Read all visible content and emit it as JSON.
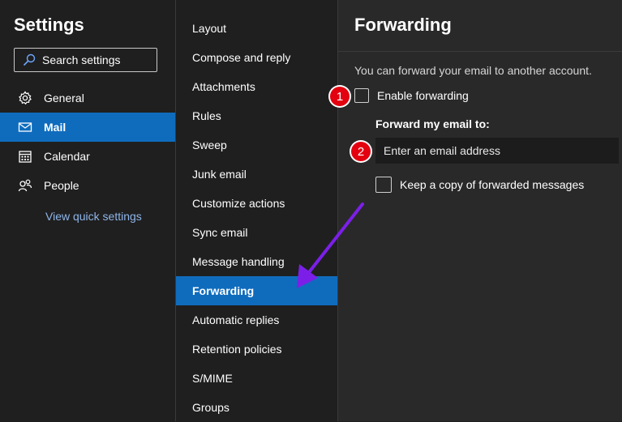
{
  "sidebar": {
    "title": "Settings",
    "search_placeholder": "Search settings",
    "items": [
      {
        "label": "General",
        "icon": "gear-icon"
      },
      {
        "label": "Mail",
        "icon": "mail-icon"
      },
      {
        "label": "Calendar",
        "icon": "calendar-icon"
      },
      {
        "label": "People",
        "icon": "people-icon"
      }
    ],
    "selected": "Mail",
    "quick_link": "View quick settings"
  },
  "submenu": {
    "items": [
      "Layout",
      "Compose and reply",
      "Attachments",
      "Rules",
      "Sweep",
      "Junk email",
      "Customize actions",
      "Sync email",
      "Message handling",
      "Forwarding",
      "Automatic replies",
      "Retention policies",
      "S/MIME",
      "Groups"
    ],
    "selected": "Forwarding"
  },
  "pane": {
    "title": "Forwarding",
    "description": "You can forward your email to another account.",
    "enable_label": "Enable forwarding",
    "enable_checked": false,
    "forward_to_label": "Forward my email to:",
    "email_placeholder": "Enter an email address",
    "keep_copy_label": "Keep a copy of forwarded messages",
    "keep_copy_checked": false
  },
  "annotations": {
    "badge1": "1",
    "badge2": "2",
    "badge_color": "#e3000f",
    "arrow_color": "#7b1fe8"
  },
  "colors": {
    "accent": "#0f6cbd",
    "background": "#1f1f1f",
    "pane_background": "#292929"
  }
}
